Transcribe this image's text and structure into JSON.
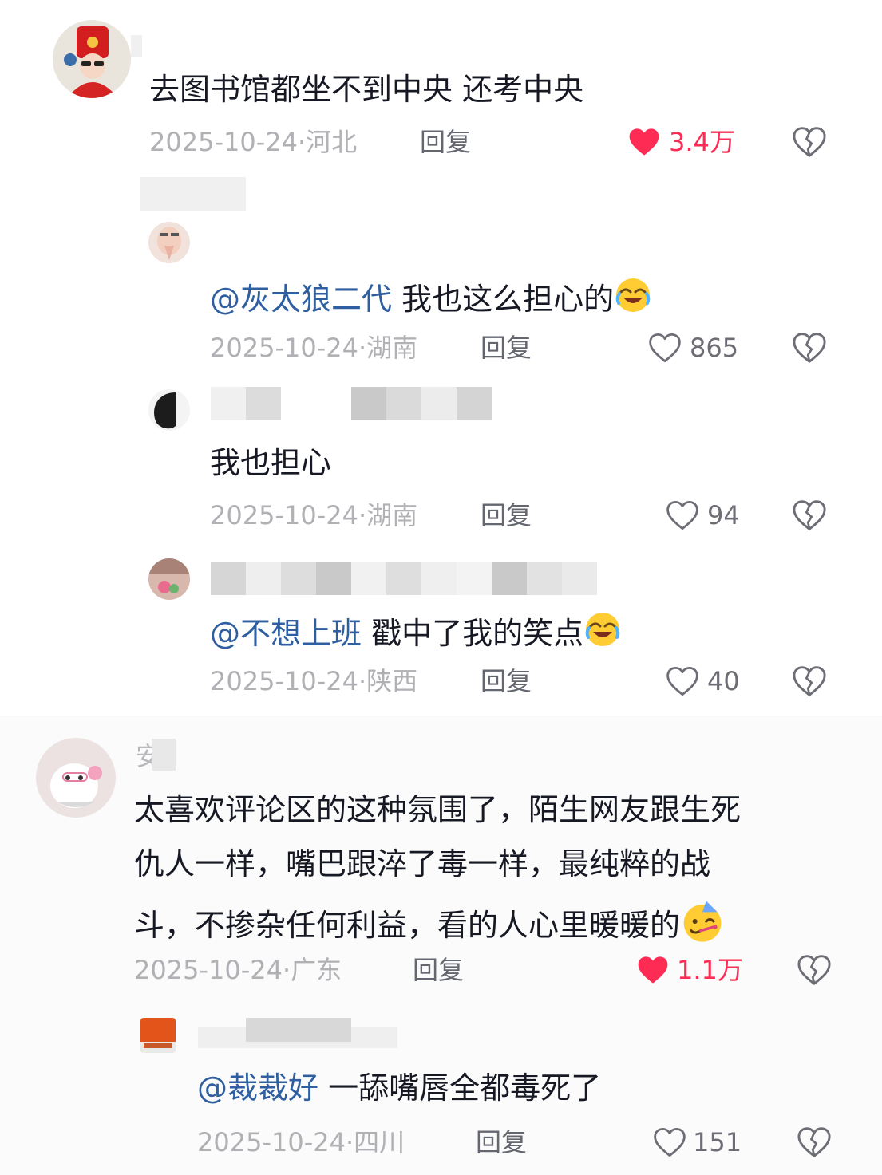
{
  "comments": [
    {
      "text": "去图书馆都坐不到中央  还考中央",
      "date": "2025-10-24",
      "location": "河北",
      "reply_label": "回复",
      "likes": "3.4万",
      "liked": true,
      "replies": [
        {
          "mention": "@灰太狼二代",
          "text": "我也这么担心的",
          "emoji": "rofl-face",
          "date": "2025-10-24",
          "location": "湖南",
          "reply_label": "回复",
          "likes": "865"
        },
        {
          "text": "我也担心",
          "date": "2025-10-24",
          "location": "湖南",
          "reply_label": "回复",
          "likes": "94"
        },
        {
          "mention": "@不想上班",
          "text": "戳中了我的笑点",
          "emoji": "rofl-face",
          "date": "2025-10-24",
          "location": "陕西",
          "reply_label": "回复",
          "likes": "40"
        }
      ]
    },
    {
      "username_partial": "安",
      "lines": [
        "太喜欢评论区的这种氛围了，陌生网友跟生死",
        "仇人一样，嘴巴跟淬了毒一样，最纯粹的战",
        "斗，不掺杂任何利益，看的人心里暖暖的"
      ],
      "emoji": "party-face",
      "date": "2025-10-24",
      "location": "广东",
      "reply_label": "回复",
      "likes": "1.1万",
      "liked": true,
      "replies": [
        {
          "mention": "@裁裁好",
          "text": "一舔嘴唇全都毒死了",
          "date": "2025-10-24",
          "location": "四川",
          "reply_label": "回复",
          "likes": "151"
        }
      ]
    }
  ],
  "icons": {
    "like": "heart-icon",
    "dislike": "broken-heart-icon"
  },
  "colors": {
    "liked": "#fe2c55",
    "mention": "#2f5fa0",
    "meta": "#b0b0b5"
  }
}
